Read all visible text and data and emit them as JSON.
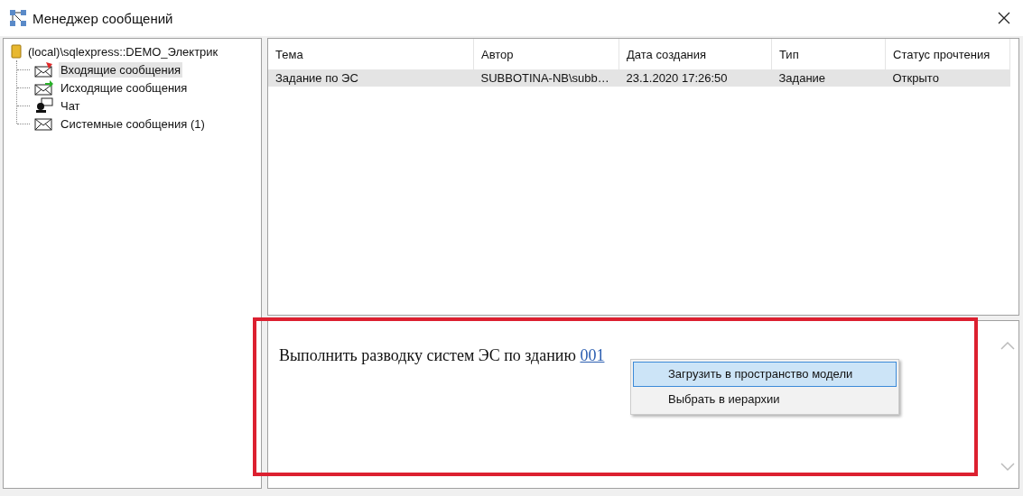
{
  "window": {
    "title": "Менеджер сообщений"
  },
  "tree": {
    "label": "(local)\\sqlexpress::DEMO_Электрик",
    "kind": "database",
    "children": [
      {
        "label": "Входящие сообщения",
        "kind": "inbox",
        "selected": true
      },
      {
        "label": "Исходящие сообщения",
        "kind": "outbox",
        "selected": false
      },
      {
        "label": "Чат",
        "kind": "chat",
        "selected": false
      },
      {
        "label": "Системные сообщения (1)",
        "kind": "mail",
        "selected": false
      }
    ]
  },
  "table": {
    "columns": [
      "Тема",
      "Автор",
      "Дата создания",
      "Тип",
      "Статус прочтения"
    ],
    "rows": [
      {
        "cells": [
          "Задание по ЭС",
          "SUBBOTINA-NB\\subb…",
          "23.1.2020 17:26:50",
          "Задание",
          "Открыто"
        ],
        "selected": true
      }
    ]
  },
  "message": {
    "text": "Выполнить разводку систем ЭС по зданию",
    "link": "001"
  },
  "context_menu": {
    "items": [
      {
        "label": "Загрузить в пространство модели",
        "selected": true
      },
      {
        "label": "Выбрать в иерархии",
        "selected": false
      }
    ]
  },
  "highlight_frame": true
}
